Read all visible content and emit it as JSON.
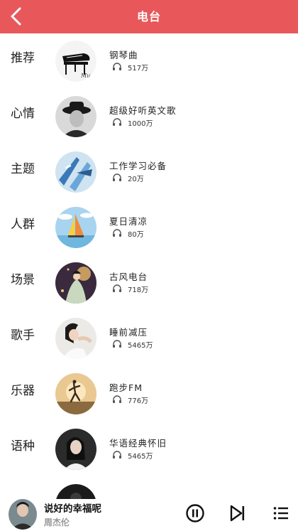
{
  "header": {
    "title": "电台",
    "back_icon": "chevron-left-icon",
    "color": "#e8585a"
  },
  "stations": [
    {
      "category": "推荐",
      "name": "钢琴曲",
      "plays": "517万"
    },
    {
      "category": "心情",
      "name": "超级好听英文歌",
      "plays": "1000万"
    },
    {
      "category": "主题",
      "name": "工作学习必备",
      "plays": "20万"
    },
    {
      "category": "人群",
      "name": "夏日清凉",
      "plays": "80万"
    },
    {
      "category": "场景",
      "name": "古风电台",
      "plays": "718万"
    },
    {
      "category": "歌手",
      "name": "睡前减压",
      "plays": "5465万"
    },
    {
      "category": "乐器",
      "name": "跑步FM",
      "plays": "776万"
    },
    {
      "category": "语种",
      "name": "华语经典怀旧",
      "plays": "5465万"
    }
  ],
  "player": {
    "song": "说好的幸福呢",
    "artist": "周杰伦",
    "pause_icon": "pause-icon",
    "next_icon": "skip-next-icon",
    "playlist_icon": "playlist-icon"
  }
}
